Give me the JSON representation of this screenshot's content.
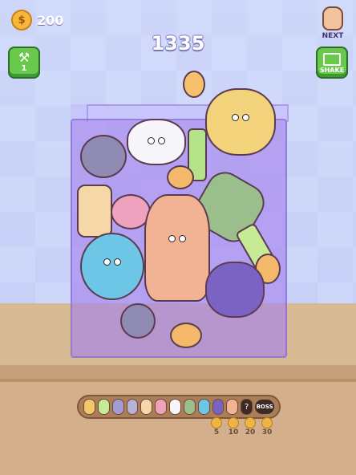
{
  "hud": {
    "coins": "200",
    "score": "1335",
    "next_label": "NEXT",
    "hammer_count": "1",
    "shake_label": "SHAKE"
  },
  "progress": {
    "boss_label": "BOSS",
    "unknown_label": "?",
    "milestones": [
      "5",
      "10",
      "20",
      "30"
    ]
  },
  "icons": {
    "coin": "coin-icon",
    "hammer": "hammer-icon",
    "shake": "shake-icon",
    "next": "next-monster-icon"
  }
}
